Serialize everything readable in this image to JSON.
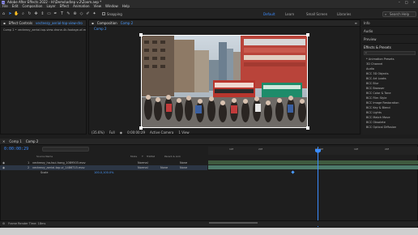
{
  "app": {
    "title": "Adobe After Effects 2022 - H:\\Demo\\ad\\ep v.2\\Zoom.aep *",
    "window_buttons": [
      "–",
      "□",
      "✕"
    ]
  },
  "menu": [
    "File",
    "Edit",
    "Composition",
    "Layer",
    "Effect",
    "Animation",
    "View",
    "Window",
    "Help"
  ],
  "toolbar": {
    "tools": [
      "home-icon",
      "selection-icon",
      "hand-icon",
      "zoom-icon",
      "orbit-icon",
      "pan-icon",
      "dolly-icon",
      "rect-icon",
      "pen-icon",
      "type-icon",
      "brush-icon",
      "clone-icon",
      "eraser-icon",
      "roto-icon",
      "puppet-icon"
    ],
    "snapping_label": "Snapping",
    "workspaces": [
      "Default",
      "Learn",
      "Small Screen",
      "Libraries"
    ],
    "active_workspace": "Default",
    "search_placeholder": "Search Help"
  },
  "project_panel": {
    "tab": "Effect Controls",
    "tab_file": "vecteezy_aerial-top-view-dro",
    "breadcrumb": "Comp 2 • vecteezy_aerial-top-view-drone-4k-footage-of-modern"
  },
  "comp_panel": {
    "tab": "Composition",
    "tab_name": "Comp 2",
    "sub_tab": "Comp 2",
    "zoom": "(35.6%)",
    "resolution": "Full",
    "timecode": "0:00:00:29",
    "camera": "Active Camera",
    "views": "1 View"
  },
  "right_panel": {
    "items": [
      "Info",
      "Audio",
      "Preview"
    ],
    "effects_title": "Effects & Presets",
    "effects": [
      "* Animation Presets",
      "3D Channel",
      "Audio",
      "BCC 3D Objects",
      "BCC Art Looks",
      "BCC Blur",
      "BCC Browser",
      "BCC Color & Tone",
      "BCC Film Style",
      "BCC Image Restoration",
      "BCC Key & Blend",
      "BCC Lights",
      "BCC Match Move",
      "BCC Obsolete",
      "BCC Optical Diffusion"
    ]
  },
  "timeline": {
    "tabs": [
      "Comp 1",
      "Comp 2"
    ],
    "active_tab": "Comp 2",
    "timecode": "0:00:00:29",
    "columns": [
      "Source Name",
      "Mode",
      "T",
      "TrkMat",
      "Parent & Link"
    ],
    "layers": [
      {
        "num": "1",
        "name": "vecteezy_ha-tsui-hong_1089503.mov",
        "mode": "Normal",
        "trkmat": "",
        "parent": "None"
      },
      {
        "num": "2",
        "name": "vecteezy_aerial-top-vi_1486715.mov",
        "mode": "Normal",
        "trkmat": "None",
        "parent": "None"
      },
      {
        "num": "",
        "name": "Scale",
        "mode": "",
        "trkmat": "",
        "parent": "",
        "value": "100.0,100.0%"
      }
    ],
    "ruler_labels": [
      "10f",
      "20f",
      "01:00f",
      "10f",
      "20f"
    ],
    "footer": "Frame Render Time: 18ms"
  },
  "colors": {
    "accent": "#3b8cff",
    "track_green": "#3f5a3f",
    "track_teal": "#4d7a6a"
  }
}
